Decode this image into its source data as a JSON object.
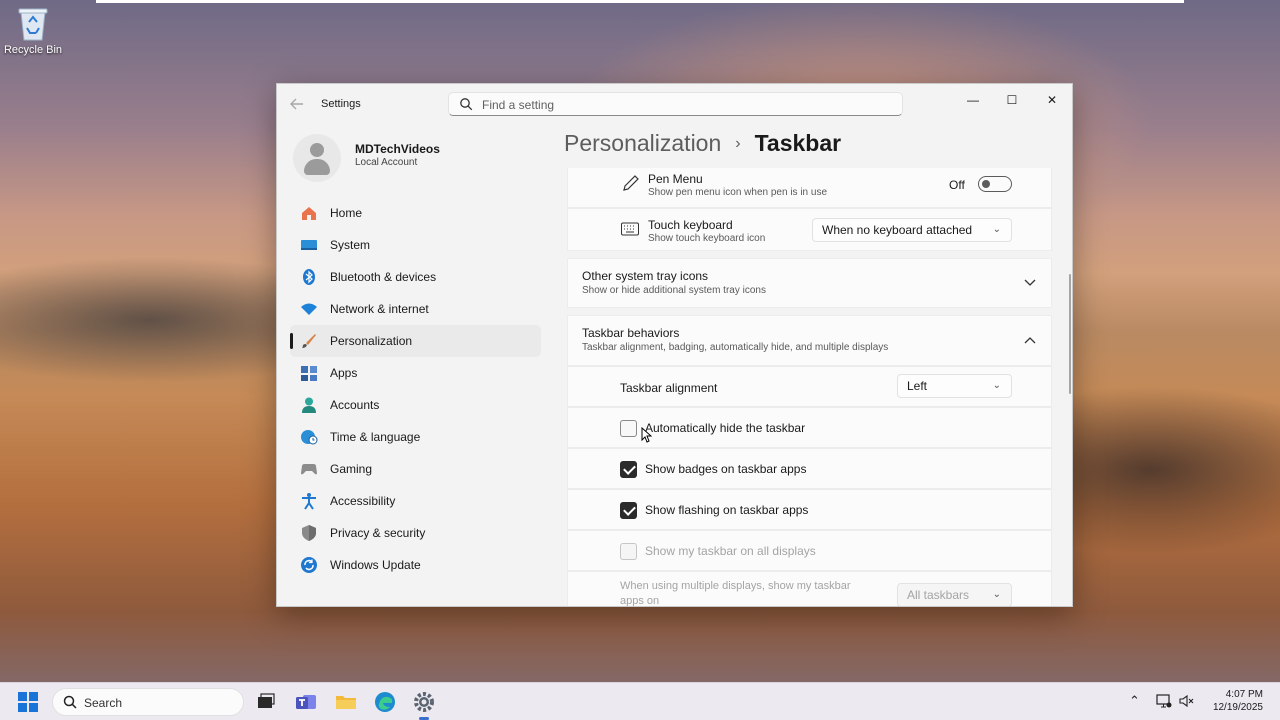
{
  "desktop": {
    "recycle_bin_label": "Recycle Bin"
  },
  "window": {
    "app_title": "Settings",
    "search_placeholder": "Find a setting",
    "controls": {
      "minimize": "—",
      "maximize": "☐",
      "close": "✕"
    }
  },
  "profile": {
    "name": "MDTechVideos",
    "account_type": "Local Account"
  },
  "nav": {
    "items": [
      {
        "label": "Home",
        "icon": "home-icon"
      },
      {
        "label": "System",
        "icon": "monitor-icon"
      },
      {
        "label": "Bluetooth & devices",
        "icon": "bluetooth-icon"
      },
      {
        "label": "Network & internet",
        "icon": "wifi-icon"
      },
      {
        "label": "Personalization",
        "icon": "brush-icon",
        "active": true
      },
      {
        "label": "Apps",
        "icon": "apps-icon"
      },
      {
        "label": "Accounts",
        "icon": "person-icon"
      },
      {
        "label": "Time & language",
        "icon": "globe-clock-icon"
      },
      {
        "label": "Gaming",
        "icon": "gamepad-icon"
      },
      {
        "label": "Accessibility",
        "icon": "accessibility-icon"
      },
      {
        "label": "Privacy & security",
        "icon": "shield-icon"
      },
      {
        "label": "Windows Update",
        "icon": "update-icon"
      }
    ]
  },
  "breadcrumb": {
    "parent": "Personalization",
    "separator": "›",
    "current": "Taskbar"
  },
  "main": {
    "pen_menu": {
      "title": "Pen Menu",
      "subtitle": "Show pen menu icon when pen is in use",
      "state_label": "Off",
      "on": false
    },
    "touch_keyboard": {
      "title": "Touch keyboard",
      "subtitle": "Show touch keyboard icon",
      "value": "When no keyboard attached"
    },
    "other_tray": {
      "title": "Other system tray icons",
      "subtitle": "Show or hide additional system tray icons"
    },
    "behaviors": {
      "title": "Taskbar behaviors",
      "subtitle": "Taskbar alignment, badging, automatically hide, and multiple displays"
    },
    "alignment": {
      "label": "Taskbar alignment",
      "value": "Left"
    },
    "auto_hide": {
      "label": "Automatically hide the taskbar",
      "checked": false
    },
    "badges": {
      "label": "Show badges on taskbar apps",
      "checked": true
    },
    "flashing": {
      "label": "Show flashing on taskbar apps",
      "checked": true
    },
    "all_displays": {
      "label": "Show my taskbar on all displays",
      "checked": false,
      "disabled": true
    },
    "multi_display": {
      "label_line1": "When using multiple displays, show my taskbar",
      "label_line2": "apps on",
      "value": "All taskbars",
      "disabled": true
    }
  },
  "taskbar": {
    "search_label": "Search",
    "apps": [
      "task-view-icon",
      "teams-icon",
      "file-explorer-icon",
      "edge-icon",
      "settings-icon"
    ],
    "tray": {
      "chevron": "⌃"
    },
    "time": "4:07 PM",
    "date": "12/19/2025"
  },
  "colors": {
    "accent": "#1a73d6",
    "checkbox_checked": "#2b2b2b",
    "window_bg": "#f3f3f3",
    "card_bg": "#fbfbfb"
  }
}
